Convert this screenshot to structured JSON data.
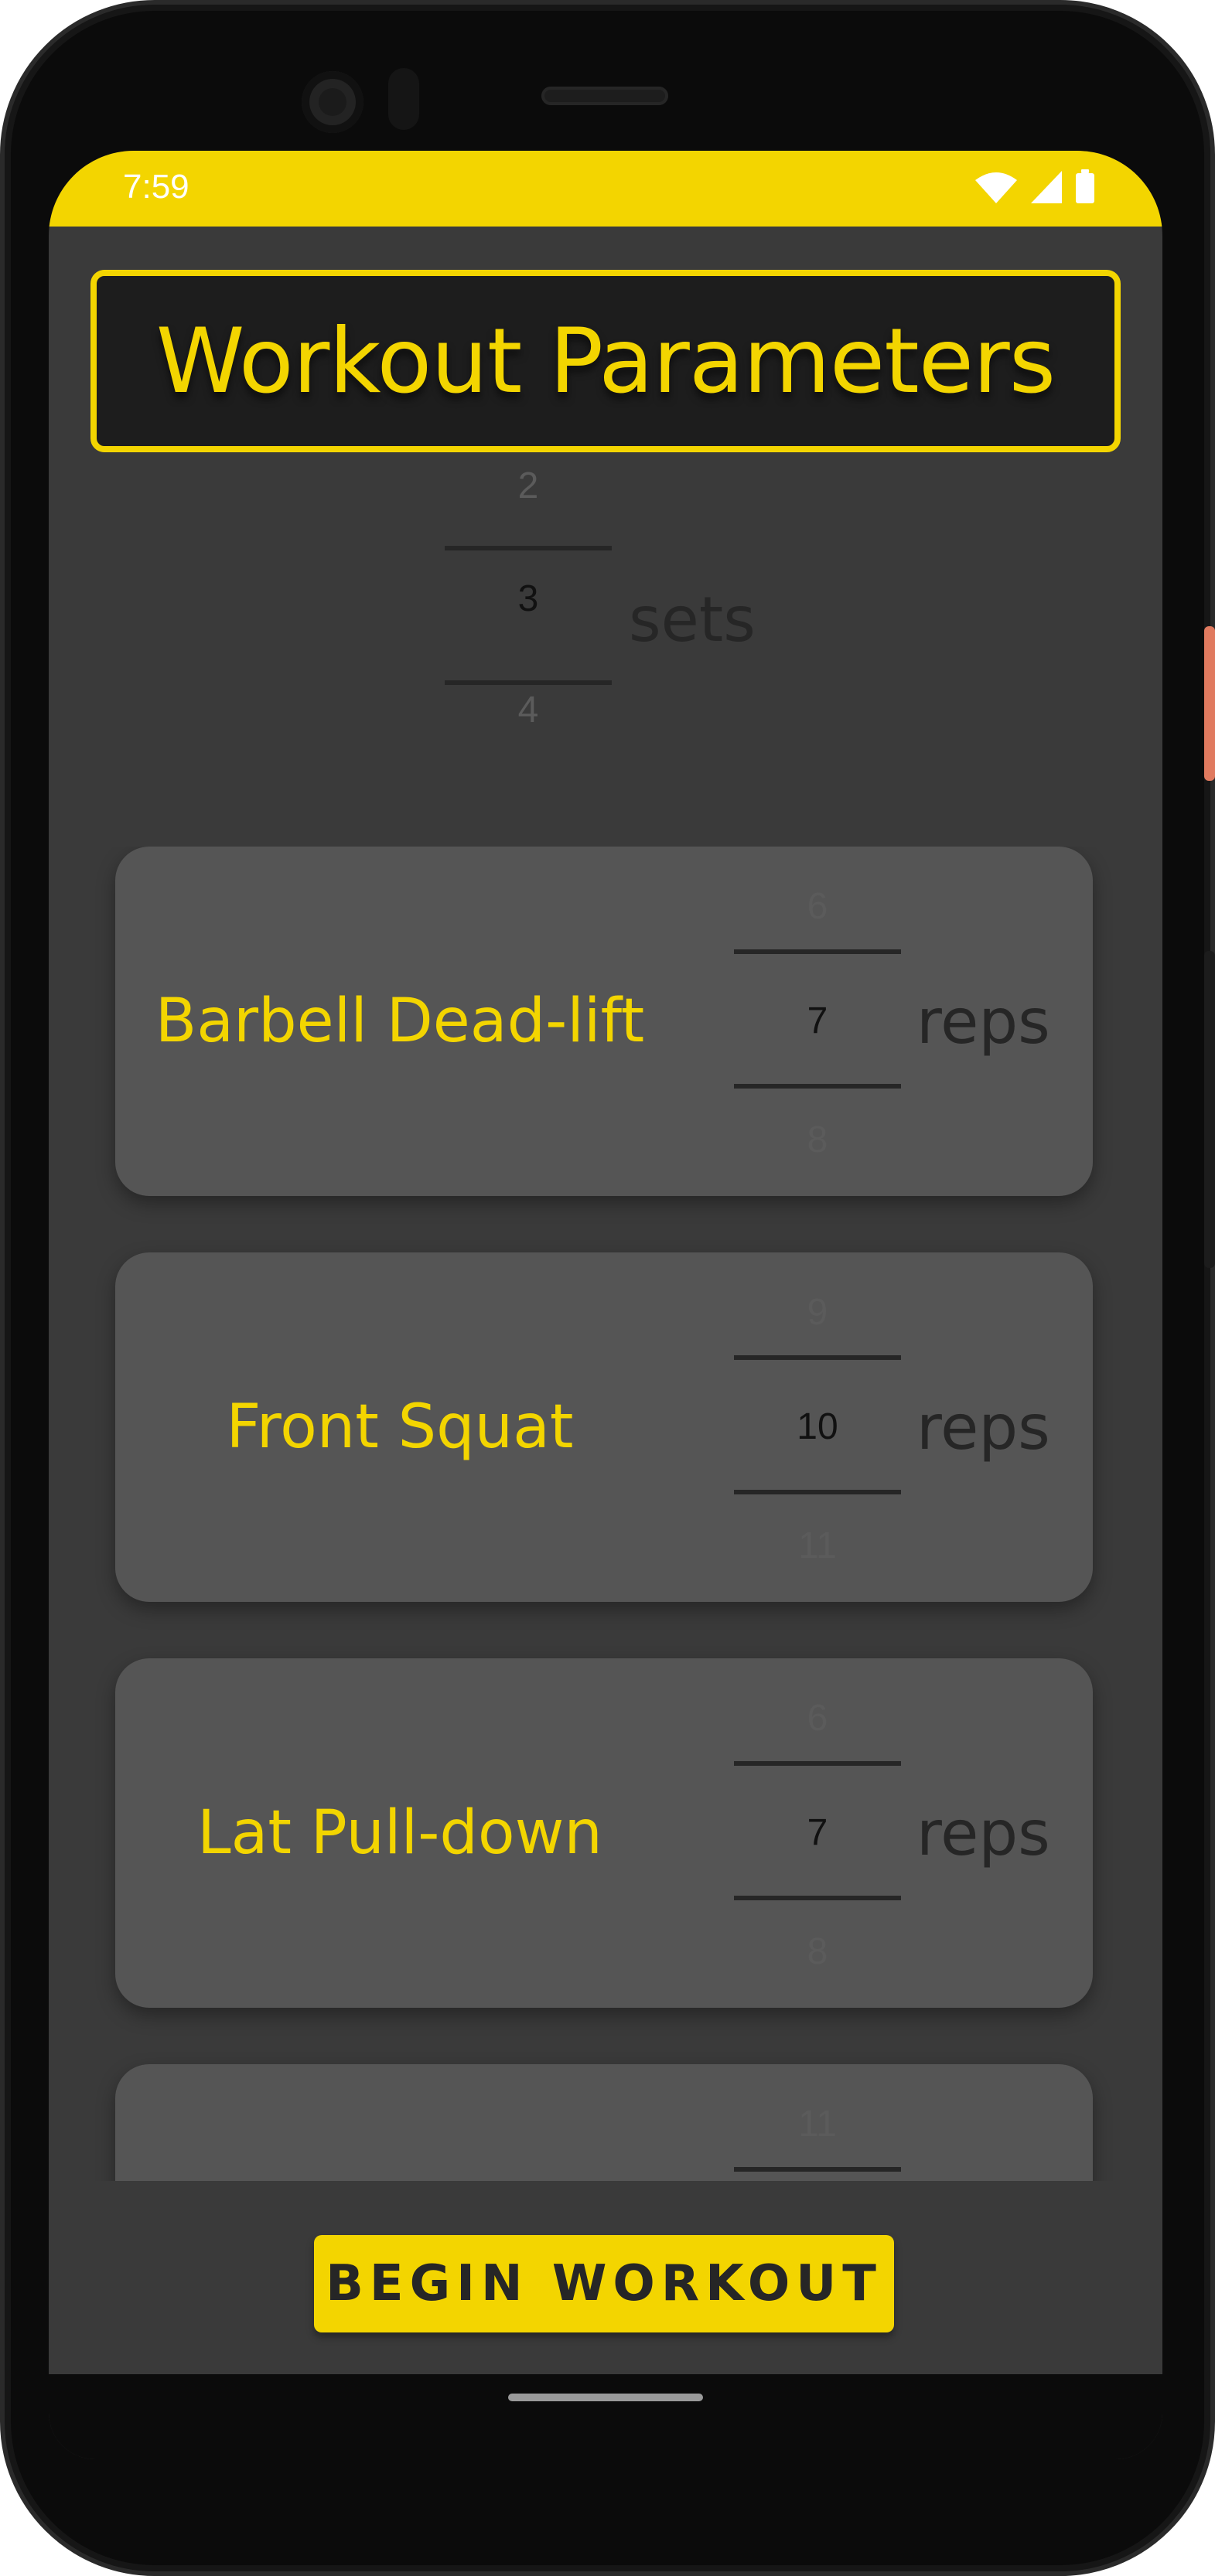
{
  "status_bar": {
    "time": "7:59",
    "icons": [
      "wifi-icon",
      "cell-signal-icon",
      "battery-icon"
    ],
    "color": "#f3d500"
  },
  "title": "Workout Parameters",
  "sets_picker": {
    "above": "2",
    "selected": "3",
    "below": "4",
    "unit": "sets"
  },
  "exercises": [
    {
      "name": "Barbell Dead-lift",
      "above": "6",
      "selected": "7",
      "below": "8",
      "unit": "reps"
    },
    {
      "name": "Front Squat",
      "above": "9",
      "selected": "10",
      "below": "11",
      "unit": "reps"
    },
    {
      "name": "Lat Pull-down",
      "above": "6",
      "selected": "7",
      "below": "8",
      "unit": "reps"
    },
    {
      "name": "",
      "above": "11",
      "selected": "",
      "below": "",
      "unit": ""
    }
  ],
  "begin_button_label": "BEGIN WORKOUT",
  "colors": {
    "accent": "#f3d500",
    "background": "#3a3a3a",
    "card": "#555555",
    "title_box": "#1d1d1d"
  }
}
